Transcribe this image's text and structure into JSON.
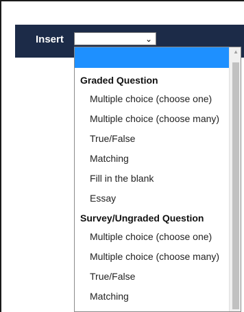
{
  "toolbar": {
    "insert_label": "Insert",
    "select_value": "",
    "chevron_icon": "chevron-down-icon"
  },
  "dropdown": {
    "selected_option": "",
    "groups": [
      {
        "label": "Graded Question",
        "options": [
          "Multiple choice (choose one)",
          "Multiple choice (choose many)",
          "True/False",
          "Matching",
          "Fill in the blank",
          "Essay"
        ]
      },
      {
        "label": "Survey/Ungraded Question",
        "options": [
          "Multiple choice (choose one)",
          "Multiple choice (choose many)",
          "True/False",
          "Matching"
        ]
      }
    ]
  },
  "colors": {
    "header_bg": "#1c2b48",
    "selected_bg": "#1e90ff"
  }
}
